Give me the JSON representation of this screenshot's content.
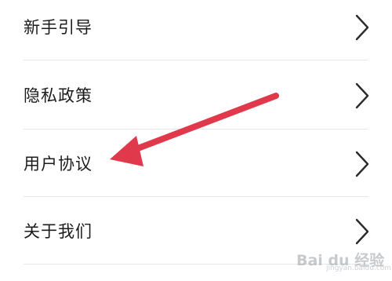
{
  "settings": {
    "items": [
      {
        "label": "新手引导",
        "icon": "chevron-right-icon"
      },
      {
        "label": "隐私政策",
        "icon": "chevron-right-icon"
      },
      {
        "label": "用户协议",
        "icon": "chevron-right-icon"
      },
      {
        "label": "关于我们",
        "icon": "chevron-right-icon"
      }
    ]
  },
  "annotation": {
    "arrow_color": "#e0394b",
    "points_to": "用户协议"
  },
  "watermark": {
    "brand": "Bai du 经验",
    "sub": "jingyan.baidu.com"
  },
  "colors": {
    "text": "#1c1c1c",
    "divider": "#e6e6e6",
    "chevron": "#2b2b2b",
    "background": "#ffffff"
  }
}
